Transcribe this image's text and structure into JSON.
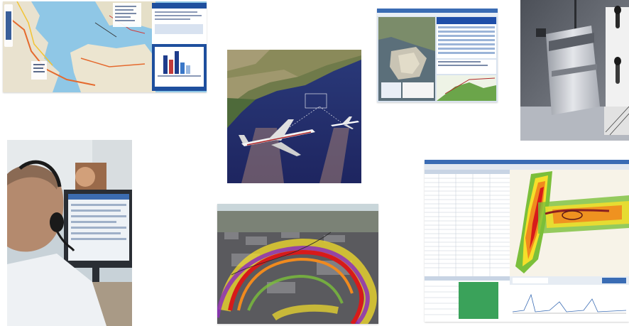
{
  "collage": {
    "panels": [
      {
        "name": "map-portal-screenshot"
      },
      {
        "name": "aircraft-flight-simulation"
      },
      {
        "name": "gis-report-screenshot"
      },
      {
        "name": "noise-monitoring-station-photo"
      },
      {
        "name": "operator-at-workstation-photo"
      },
      {
        "name": "3d-noise-contour-map"
      },
      {
        "name": "noise-contour-software-screenshot"
      }
    ]
  },
  "colors": {
    "water": "#8fc7e6",
    "land": "#e9e2cf",
    "ui_blue": "#1e4f9e",
    "noise_red": "#d71a1a",
    "noise_orange": "#f08a1e",
    "noise_yellow": "#f5df2a",
    "noise_green": "#7bbf3a",
    "noise_purple": "#8c2fb8",
    "sky_night": "#1e2560"
  },
  "icons": {
    "airplane": "airplane-icon",
    "microphone": "microphone-icon",
    "headset": "headset-icon"
  }
}
